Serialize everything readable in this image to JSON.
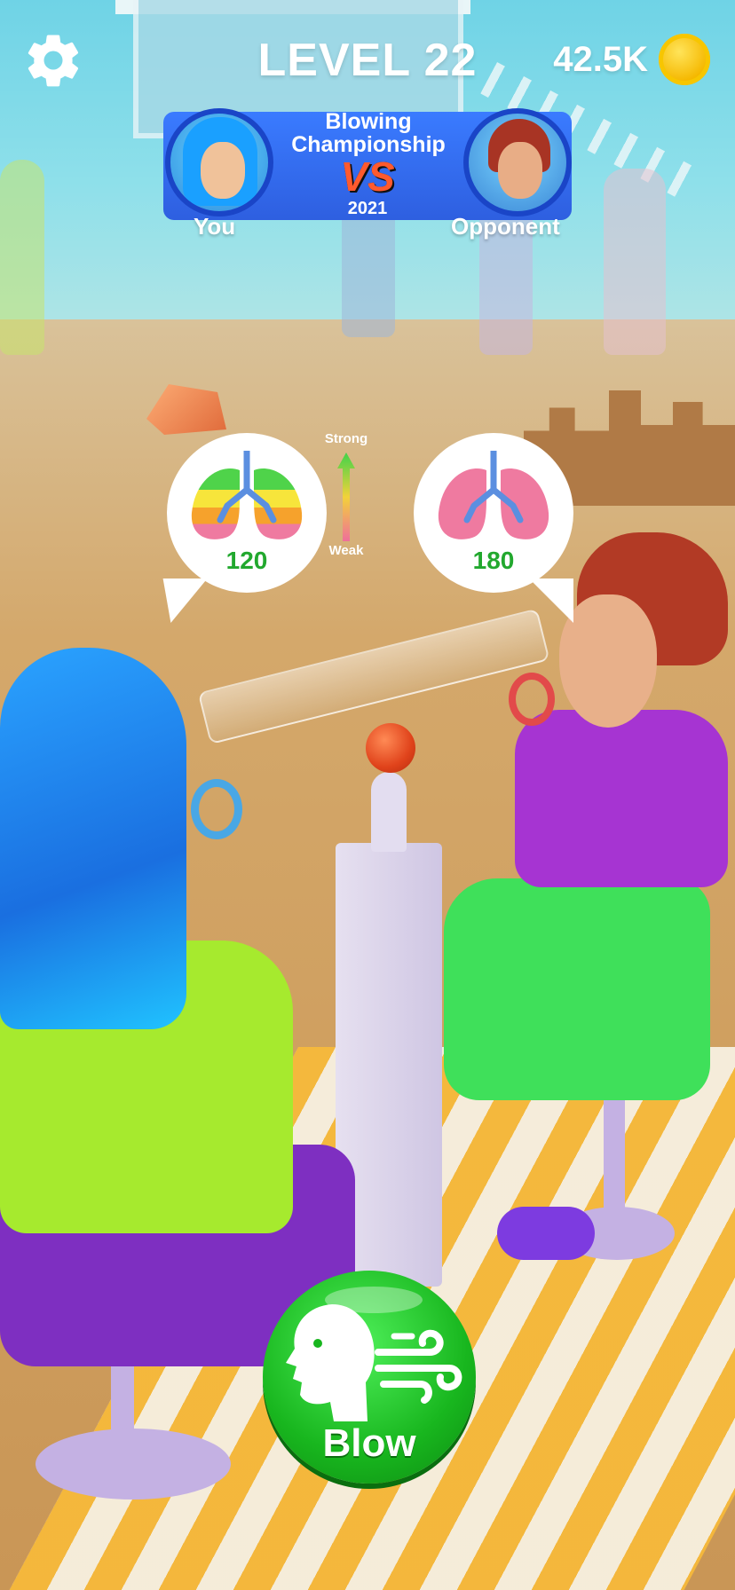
{
  "hud": {
    "level_label": "LEVEL 22",
    "coins": "42.5K",
    "settings_icon": "gear-icon",
    "coin_icon": "coin-icon"
  },
  "match": {
    "title_line1": "Blowing",
    "title_line2": "Championship",
    "vs": "VS",
    "year": "2021",
    "player_name": "You",
    "opponent_name": "Opponent",
    "banner_color": "#2e5fe0"
  },
  "lungs": {
    "player_value": "120",
    "opponent_value": "180",
    "meter_top_label": "Strong",
    "meter_bottom_label": "Weak",
    "value_color": "#22a82e"
  },
  "controls": {
    "blow_label": "Blow",
    "blow_color": "#18b61e"
  }
}
